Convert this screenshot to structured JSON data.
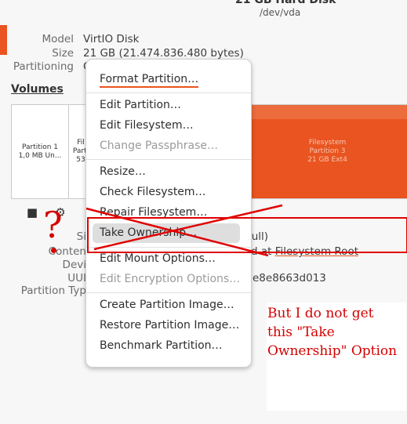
{
  "header": {
    "title": "21 GB Hard Disk",
    "subtitle": "/dev/vda"
  },
  "disk": {
    "model_label": "Model",
    "model_value": "VirtIO Disk",
    "size_label": "Size",
    "size_value": "21 GB (21.474.836.480 bytes)",
    "partitioning_label": "Partitioning",
    "partitioning_value": "G"
  },
  "volumes": {
    "heading": "Volumes",
    "segments": [
      {
        "line1": "Partition 1",
        "line2": "1,0 MB Un..."
      },
      {
        "line1": "Fil",
        "line2": "Parti",
        "line3": "53"
      },
      {
        "line1": "Filesystem",
        "line2": "Partition 3",
        "line3": "21 GB Ext4"
      }
    ]
  },
  "details": {
    "size_label": "Si",
    "size_value": "full)",
    "contents_label": "Conten",
    "contents_value_prefix": "d at ",
    "contents_link": "Filesystem Root",
    "device_label": "Devi",
    "uuid_label": "UUI",
    "uuid_value": "e8e8663d013",
    "partition_type_label": "Partition Typ"
  },
  "menu": {
    "items": [
      {
        "label": "Format Partition…",
        "enabled": true
      },
      {
        "label": "Edit Partition…",
        "enabled": true
      },
      {
        "label": "Edit Filesystem…",
        "enabled": true
      },
      {
        "label": "Change Passphrase…",
        "enabled": false
      },
      {
        "label": "Resize…",
        "enabled": true
      },
      {
        "label": "Check Filesystem…",
        "enabled": true
      },
      {
        "label": "Repair Filesystem…",
        "enabled": true
      },
      {
        "label": "Take Ownership…",
        "enabled": true
      },
      {
        "label": "Edit Mount Options…",
        "enabled": true
      },
      {
        "label": "Edit Encryption Options…",
        "enabled": false
      },
      {
        "label": "Create Partition Image…",
        "enabled": true
      },
      {
        "label": "Restore Partition Image…",
        "enabled": true
      },
      {
        "label": "Benchmark Partition…",
        "enabled": true
      }
    ]
  },
  "annotation": {
    "question_mark": "?",
    "text": "But I do not get this \"Take Ownership\" Option",
    "color": "#d40000"
  },
  "colors": {
    "accent": "#e95420",
    "annotation_red": "#e00000"
  },
  "icons": {
    "stop": "stop-icon",
    "settings": "gear-icon"
  }
}
